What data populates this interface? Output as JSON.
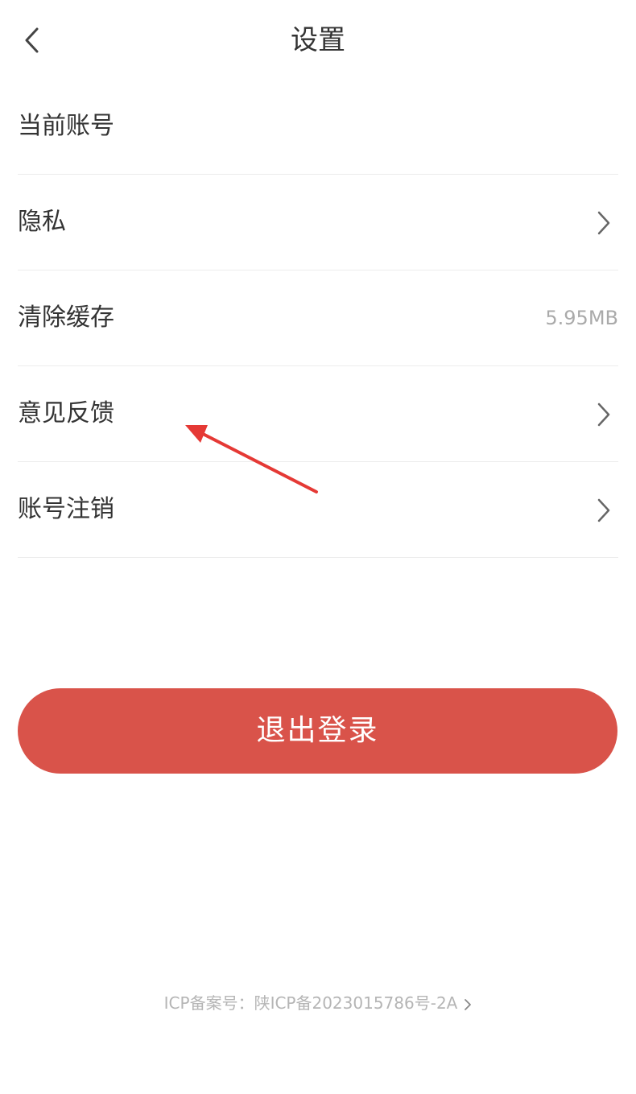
{
  "header": {
    "title": "设置",
    "back_icon": "chevron-left-icon"
  },
  "menu": {
    "items": [
      {
        "label": "当前账号",
        "value": "",
        "has_chevron": false
      },
      {
        "label": "隐私",
        "value": "",
        "has_chevron": true
      },
      {
        "label": "清除缓存",
        "value": "5.95MB",
        "has_chevron": false
      },
      {
        "label": "意见反馈",
        "value": "",
        "has_chevron": true
      },
      {
        "label": "账号注销",
        "value": "",
        "has_chevron": true
      }
    ]
  },
  "logout": {
    "label": "退出登录",
    "color": "#d9534a"
  },
  "footer": {
    "icp_text": "ICP备案号：陕ICP备2023015786号-2A"
  },
  "annotation": {
    "color": "#e53935",
    "target": "意见反馈"
  }
}
